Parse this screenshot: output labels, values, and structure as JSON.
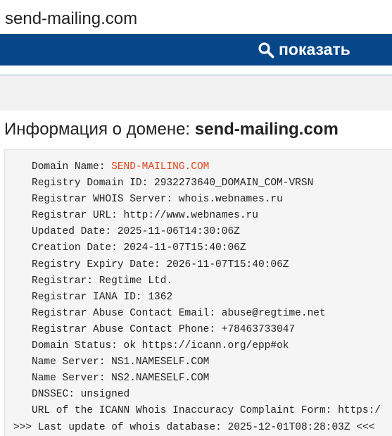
{
  "search": {
    "value": "send-mailing.com"
  },
  "toolbar": {
    "show_label": "показать",
    "accent_color": "#064789"
  },
  "title": {
    "prefix": "Информация о домене:",
    "domain": "send-mailing.com"
  },
  "whois": {
    "lines": [
      {
        "key": "Domain Name:",
        "value": "SEND-MAILING.COM",
        "highlight": true
      },
      {
        "key": "Registry Domain ID:",
        "value": "2932273640_DOMAIN_COM-VRSN"
      },
      {
        "key": "Registrar WHOIS Server:",
        "value": "whois.webnames.ru"
      },
      {
        "key": "Registrar URL:",
        "value": "http://www.webnames.ru"
      },
      {
        "key": "Updated Date:",
        "value": "2025-11-06T14:30:06Z"
      },
      {
        "key": "Creation Date:",
        "value": "2024-11-07T15:40:06Z"
      },
      {
        "key": "Registry Expiry Date:",
        "value": "2026-11-07T15:40:06Z"
      },
      {
        "key": "Registrar:",
        "value": "Regtime Ltd."
      },
      {
        "key": "Registrar IANA ID:",
        "value": "1362"
      },
      {
        "key": "Registrar Abuse Contact Email:",
        "value": "abuse@regtime.net"
      },
      {
        "key": "Registrar Abuse Contact Phone:",
        "value": "+78463733047"
      },
      {
        "key": "Domain Status:",
        "value": "ok https://icann.org/epp#ok"
      },
      {
        "key": "Name Server:",
        "value": "NS1.NAMESELF.COM"
      },
      {
        "key": "Name Server:",
        "value": "NS2.NAMESELF.COM"
      },
      {
        "key": "DNSSEC:",
        "value": "unsigned"
      },
      {
        "key": "URL of the ICANN Whois Inaccuracy Complaint Form:",
        "value": "https:/"
      }
    ],
    "footer": ">>> Last update of whois database: 2025-12-01T08:28:03Z <<<",
    "highlight_color": "#e4471d"
  }
}
